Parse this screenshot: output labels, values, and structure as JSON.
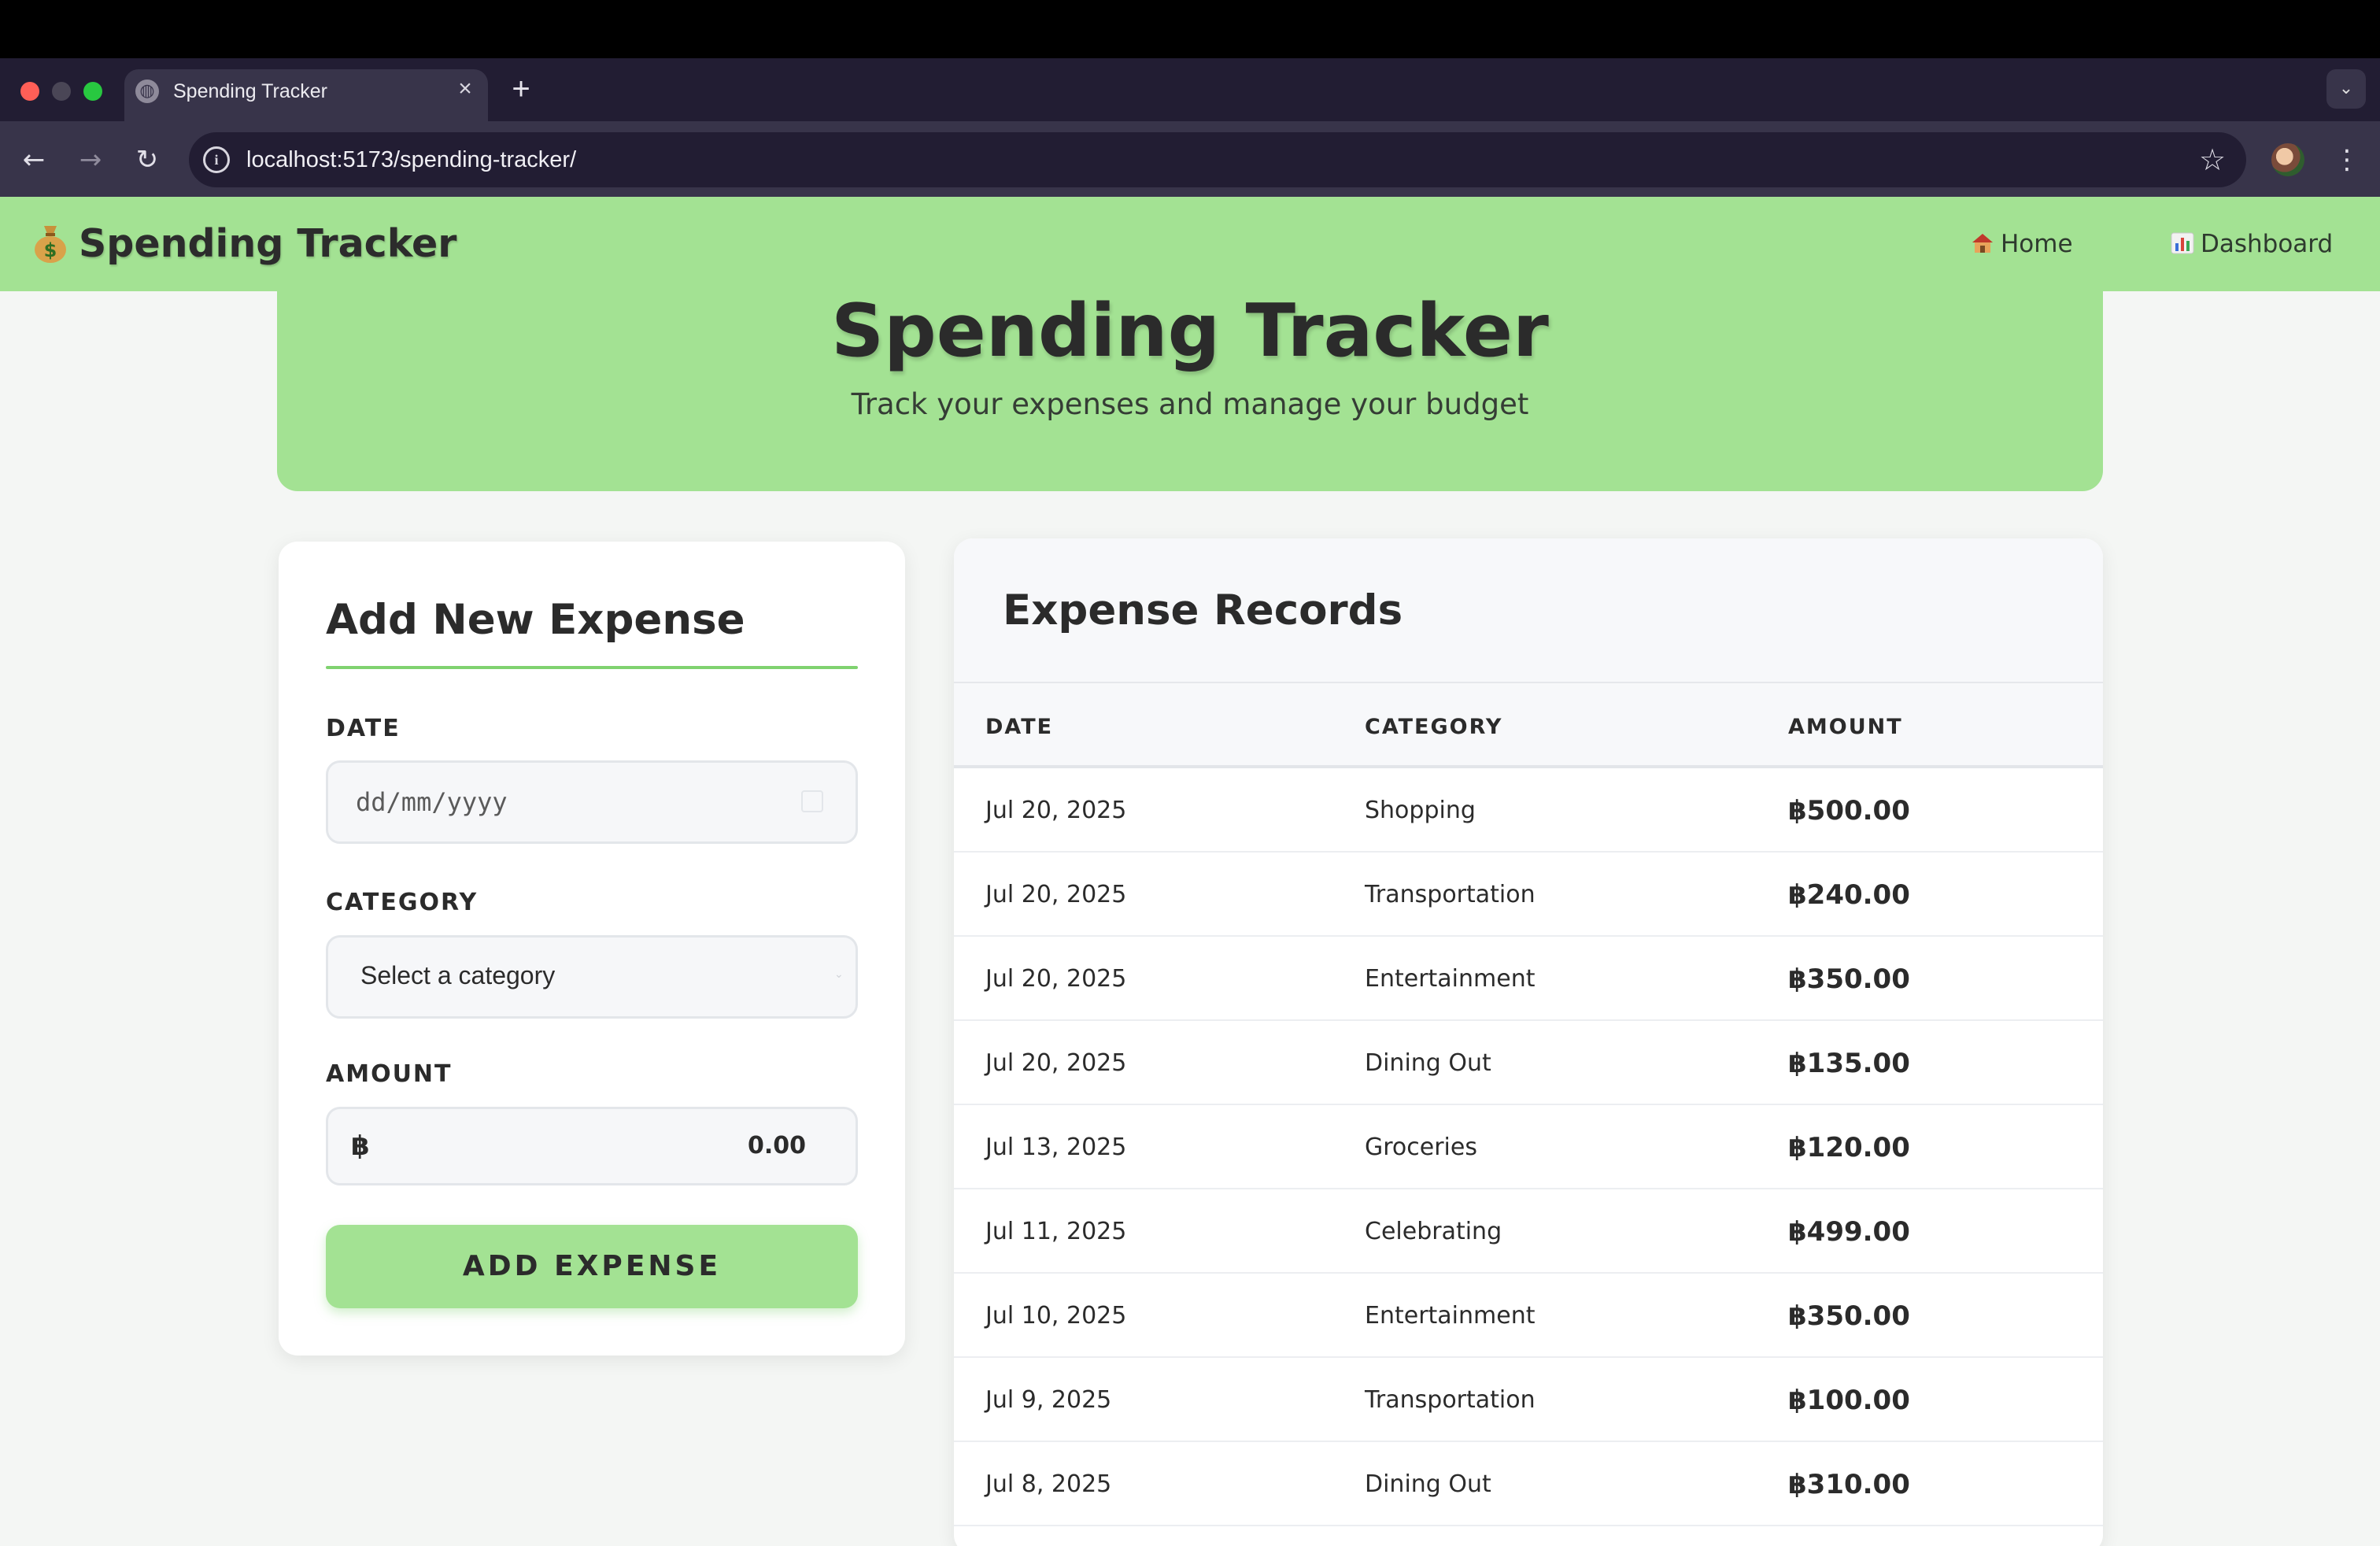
{
  "browser": {
    "tab_title": "Spending Tracker",
    "url": "localhost:5173/spending-tracker/"
  },
  "nav": {
    "brand": "Spending Tracker",
    "home": "Home",
    "dashboard": "Dashboard"
  },
  "hero": {
    "title": "Spending Tracker",
    "subtitle": "Track your expenses and manage your budget"
  },
  "form": {
    "title": "Add New Expense",
    "date_label": "DATE",
    "date_placeholder": "dd/mm/yyyy",
    "category_label": "CATEGORY",
    "category_selected": "Select a category",
    "amount_label": "AMOUNT",
    "currency_symbol": "฿",
    "amount_placeholder": "0.00",
    "submit_label": "ADD EXPENSE"
  },
  "records": {
    "title": "Expense Records",
    "columns": [
      "DATE",
      "CATEGORY",
      "AMOUNT"
    ],
    "rows": [
      {
        "date": "Jul 20, 2025",
        "category": "Shopping",
        "amount": "฿500.00"
      },
      {
        "date": "Jul 20, 2025",
        "category": "Transportation",
        "amount": "฿240.00"
      },
      {
        "date": "Jul 20, 2025",
        "category": "Entertainment",
        "amount": "฿350.00"
      },
      {
        "date": "Jul 20, 2025",
        "category": "Dining Out",
        "amount": "฿135.00"
      },
      {
        "date": "Jul 13, 2025",
        "category": "Groceries",
        "amount": "฿120.00"
      },
      {
        "date": "Jul 11, 2025",
        "category": "Celebrating",
        "amount": "฿499.00"
      },
      {
        "date": "Jul 10, 2025",
        "category": "Entertainment",
        "amount": "฿350.00"
      },
      {
        "date": "Jul 9, 2025",
        "category": "Transportation",
        "amount": "฿100.00"
      },
      {
        "date": "Jul 8, 2025",
        "category": "Dining Out",
        "amount": "฿310.00"
      }
    ]
  },
  "colors": {
    "accent_green": "#a3e293",
    "rule_green": "#7fd26f",
    "text_dark": "#2b2b2b",
    "chrome_dark": "#221d33",
    "chrome_mid": "#38344a"
  },
  "icons": {
    "brand": "money-bag-icon",
    "home": "house-icon",
    "dashboard": "bar-chart-icon"
  }
}
